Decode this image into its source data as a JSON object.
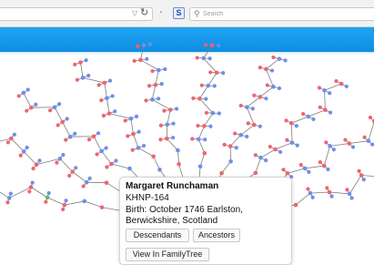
{
  "browser": {
    "search_placeholder": "Search",
    "icons": [
      "dropdown-icon",
      "reload-icon",
      "rss-icon",
      "s-icon",
      "search-icon"
    ]
  },
  "header": {
    "color": "#1a9be9"
  },
  "tree": {
    "node_colors": {
      "male": "#6f8ee8",
      "female": "#ee6470",
      "selected": "#4cc94c",
      "muted": "#c8cbe8"
    },
    "link_color": "#7d7d7d"
  },
  "popup": {
    "name": "Margaret Runchaman",
    "id": "KHNP-164",
    "birth": "Birth: October 1746 Earlston, Berwickshire, Scotland",
    "descendants_label": "Descendants",
    "ancestors_label": "Ancestors",
    "view_label": "View In FamilyTree"
  }
}
